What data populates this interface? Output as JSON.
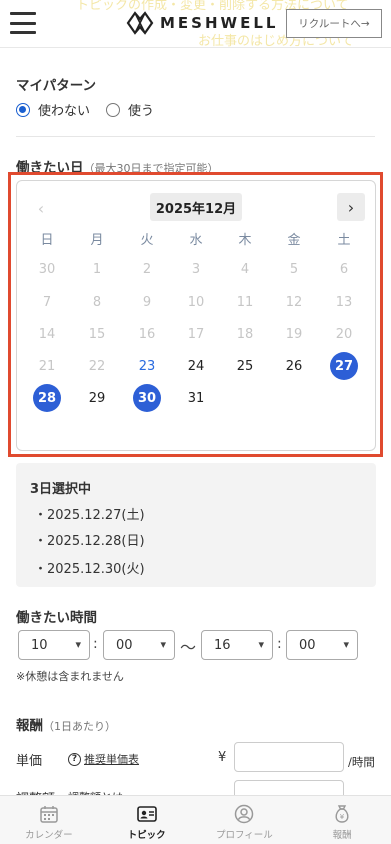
{
  "header": {
    "logo_text": "MESHWELL",
    "recruit_button": "リクルートへ→",
    "ghost_link_1": "トピックの作成・変更・削除する方法について",
    "ghost_link_2": "お仕事のはじめ方について"
  },
  "pattern": {
    "title": "マイパターン",
    "options": [
      "使わない",
      "使う"
    ],
    "selected": "使わない"
  },
  "workdays": {
    "title": "働きたい日",
    "note": "（最大30日まで指定可能）",
    "month_label": "2025年12月",
    "weekdays": [
      "日",
      "月",
      "火",
      "水",
      "木",
      "金",
      "土"
    ],
    "weeks": [
      [
        "30",
        "1",
        "2",
        "3",
        "4",
        "5",
        "6"
      ],
      [
        "7",
        "8",
        "9",
        "10",
        "11",
        "12",
        "13"
      ],
      [
        "14",
        "15",
        "16",
        "17",
        "18",
        "19",
        "20"
      ],
      [
        "21",
        "22",
        "23",
        "24",
        "25",
        "26",
        "27"
      ],
      [
        "28",
        "29",
        "30",
        "31",
        "",
        "",
        ""
      ]
    ],
    "today": "23",
    "selected_days": [
      "27",
      "28",
      "30"
    ]
  },
  "selection": {
    "title": "3日選択中",
    "items": [
      "・2025.12.27(土)",
      "・2025.12.28(日)",
      "・2025.12.30(火)"
    ]
  },
  "time": {
    "title": "働きたい時間",
    "start_hour": "10",
    "start_minute": "00",
    "separator": "〜",
    "end_hour": "16",
    "end_minute": "00",
    "note": "※休憩は含まれません"
  },
  "reward": {
    "title": "報酬",
    "note": "（1日あたり）",
    "unit_price_label": "単価",
    "unit_price_link": "推奨単価表",
    "currency": "¥",
    "per_hour": "/時間",
    "cut_label": "調整額",
    "cut_link": "調整額とは"
  },
  "bottom_nav": [
    {
      "label": "カレンダー",
      "icon": "calendar-icon",
      "active": false
    },
    {
      "label": "トピック",
      "icon": "id-card-icon",
      "active": true
    },
    {
      "label": "プロフィール",
      "icon": "person-icon",
      "active": false
    },
    {
      "label": "報酬",
      "icon": "money-bag-icon",
      "active": false
    }
  ]
}
